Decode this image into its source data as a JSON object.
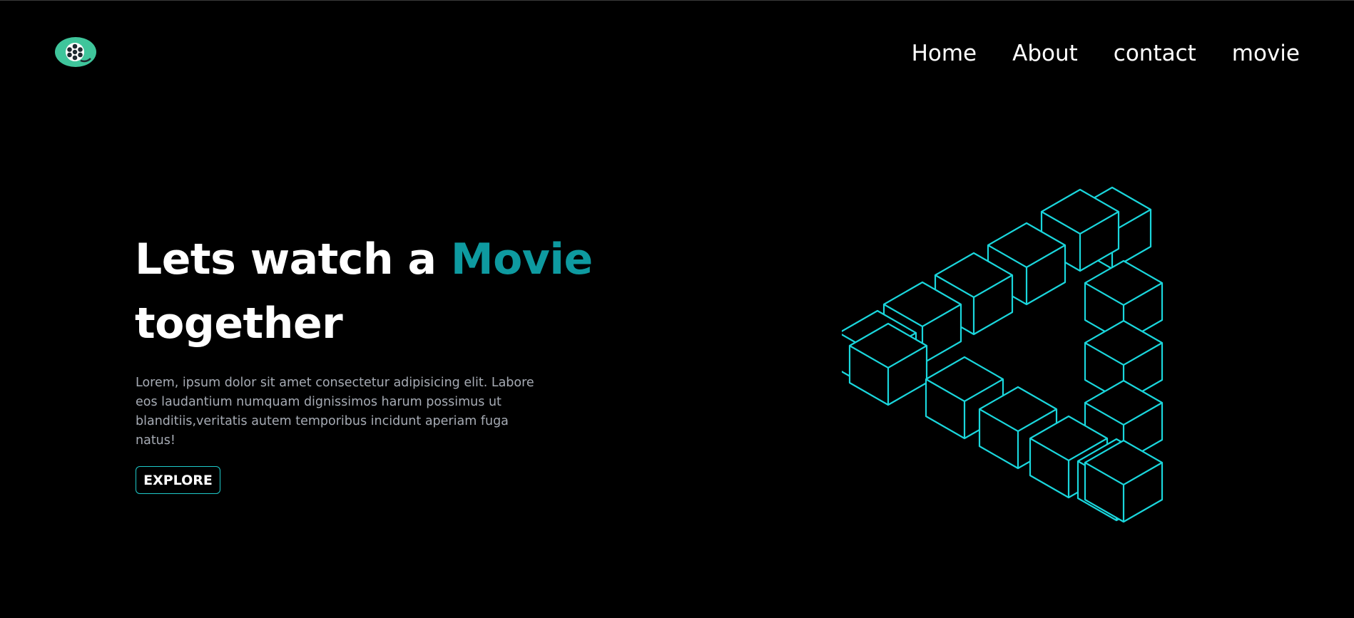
{
  "header": {
    "logo_icon": "film-reel-icon",
    "logo_color": "#3fc59b",
    "nav": [
      {
        "label": "Home"
      },
      {
        "label": "About"
      },
      {
        "label": "contact"
      },
      {
        "label": "movie"
      }
    ]
  },
  "hero": {
    "title_prefix": "Lets watch a",
    "title_accent": "Movie",
    "title_suffix": "together",
    "accent_color": "#0e9aa0",
    "description": "Lorem, ipsum dolor sit amet consectetur adipisicing elit. Labore eos laudantium numquam dignissimos harum possimus ut blanditiis,veritatis autem temporibus incidunt aperiam fuga natus!",
    "cta_label": "EXPLORE"
  },
  "illustration": {
    "icon": "impossible-triangle-cubes-icon",
    "stroke_color": "#1ad6dc"
  }
}
